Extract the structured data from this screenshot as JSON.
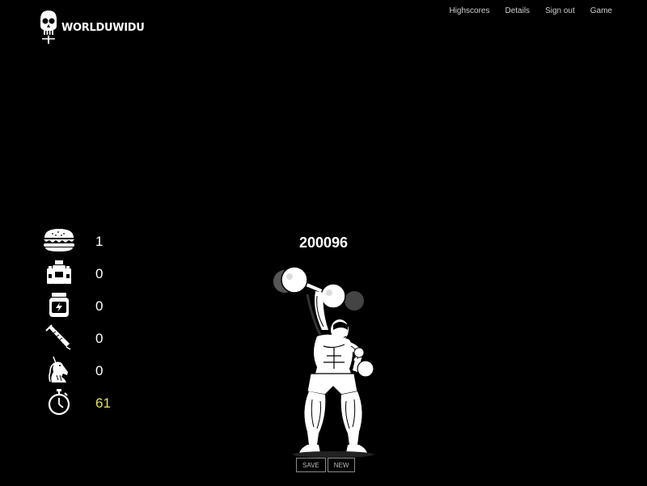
{
  "header": {
    "logo_text": "WORLDUWIDU",
    "nav": [
      "Highscores",
      "Details",
      "Sign out",
      "Game"
    ]
  },
  "stats": [
    {
      "icon": "burger-icon",
      "value": "1"
    },
    {
      "icon": "supplement-bottle-icon",
      "value": "0"
    },
    {
      "icon": "protein-jar-icon",
      "value": "0"
    },
    {
      "icon": "syringe-icon",
      "value": "0"
    },
    {
      "icon": "unicorn-icon",
      "value": "0"
    },
    {
      "icon": "stopwatch-icon",
      "value": "61",
      "color": "#e8e34a"
    }
  ],
  "game": {
    "score": "200096"
  },
  "buttons": {
    "save_label": "SAVE",
    "new_label": "NEW"
  }
}
